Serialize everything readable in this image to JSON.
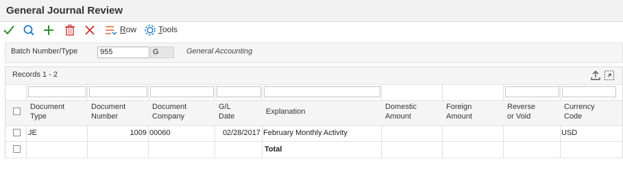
{
  "window": {
    "title": "General Journal Review"
  },
  "toolbar": {
    "row_label": "Row",
    "row_underline": "R",
    "tools_label": "Tools",
    "tools_underline": "T",
    "colors": {
      "ok": "#2e8b2e",
      "find": "#1f7bc2",
      "add": "#2e8b2e",
      "delete": "#d23c3c",
      "cancel": "#d23c3c"
    }
  },
  "header": {
    "batch_label": "Batch Number/Type",
    "batch_number": "955",
    "batch_type": "G",
    "batch_type_desc": "General Accounting"
  },
  "grid": {
    "records_text": "Records 1 - 2",
    "columns": [
      {
        "key": "doc_type",
        "label_1": "Document",
        "label_2": "Type"
      },
      {
        "key": "doc_number",
        "label_1": "Document",
        "label_2": "Number"
      },
      {
        "key": "doc_company",
        "label_1": "Document",
        "label_2": "Company"
      },
      {
        "key": "gl_date",
        "label_1": "G/L",
        "label_2": "Date"
      },
      {
        "key": "explanation",
        "label_1": "Explanation",
        "label_2": ""
      },
      {
        "key": "domestic",
        "label_1": "Domestic",
        "label_2": "Amount"
      },
      {
        "key": "foreign",
        "label_1": "Foreign",
        "label_2": "Amount"
      },
      {
        "key": "reverse",
        "label_1": "Reverse",
        "label_2": "or Void"
      },
      {
        "key": "currency",
        "label_1": "Currency",
        "label_2": "Code"
      }
    ],
    "rows": [
      {
        "doc_type": "JE",
        "doc_number": "1009",
        "doc_company": "00060",
        "gl_date": "02/28/2017",
        "explanation": "February Monthly Activity",
        "domestic": "",
        "foreign": "",
        "reverse": "",
        "currency": "USD"
      },
      {
        "doc_type": "",
        "doc_number": "",
        "doc_company": "",
        "gl_date": "",
        "explanation": "Total",
        "domestic": "",
        "foreign": "",
        "reverse": "",
        "currency": ""
      }
    ]
  }
}
